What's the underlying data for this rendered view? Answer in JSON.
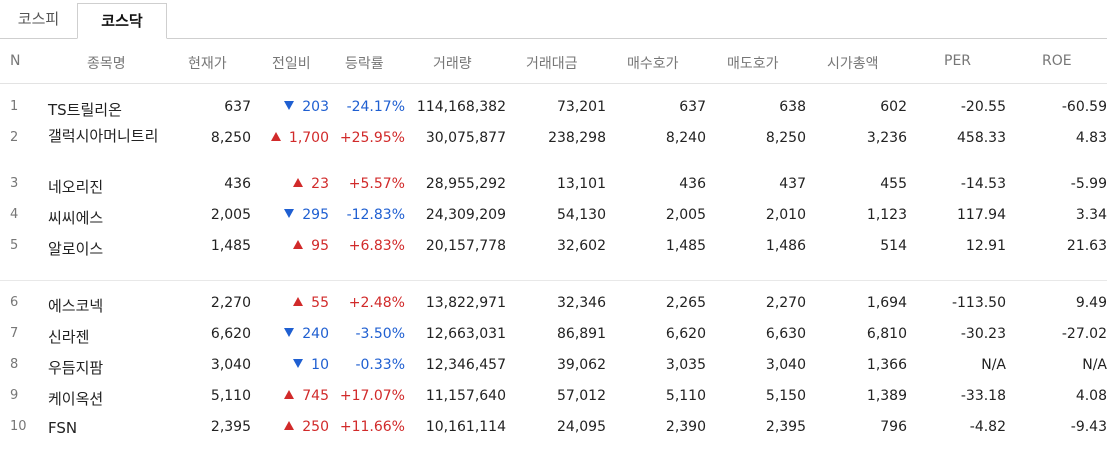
{
  "tabs": [
    {
      "label": "코스피",
      "active": false
    },
    {
      "label": "코스닥",
      "active": true
    }
  ],
  "columns": {
    "no": "N",
    "name": "종목명",
    "price": "현재가",
    "change": "전일비",
    "rate": "등락률",
    "volume": "거래량",
    "amount": "거래대금",
    "bid": "매수호가",
    "ask": "매도호가",
    "market_cap": "시가총액",
    "per": "PER",
    "roe": "ROE"
  },
  "colors": {
    "up": "#d12a2a",
    "down": "#1f5fd1"
  },
  "rows": [
    {
      "no": "1",
      "name": "TS트릴리온",
      "price": "637",
      "direction": "down",
      "change": "203",
      "rate": "-24.17%",
      "volume": "114,168,382",
      "amount": "73,201",
      "bid": "637",
      "ask": "638",
      "market_cap": "602",
      "per": "-20.55",
      "roe": "-60.59"
    },
    {
      "no": "2",
      "name": "갤럭시아머니트리",
      "price": "8,250",
      "direction": "up",
      "change": "1,700",
      "rate": "+25.95%",
      "volume": "30,075,877",
      "amount": "238,298",
      "bid": "8,240",
      "ask": "8,250",
      "market_cap": "3,236",
      "per": "458.33",
      "roe": "4.83"
    },
    {
      "no": "3",
      "name": "네오리진",
      "price": "436",
      "direction": "up",
      "change": "23",
      "rate": "+5.57%",
      "volume": "28,955,292",
      "amount": "13,101",
      "bid": "436",
      "ask": "437",
      "market_cap": "455",
      "per": "-14.53",
      "roe": "-5.99"
    },
    {
      "no": "4",
      "name": "씨씨에스",
      "price": "2,005",
      "direction": "down",
      "change": "295",
      "rate": "-12.83%",
      "volume": "24,309,209",
      "amount": "54,130",
      "bid": "2,005",
      "ask": "2,010",
      "market_cap": "1,123",
      "per": "117.94",
      "roe": "3.34"
    },
    {
      "no": "5",
      "name": "알로이스",
      "price": "1,485",
      "direction": "up",
      "change": "95",
      "rate": "+6.83%",
      "volume": "20,157,778",
      "amount": "32,602",
      "bid": "1,485",
      "ask": "1,486",
      "market_cap": "514",
      "per": "12.91",
      "roe": "21.63"
    },
    {
      "no": "6",
      "name": "에스코넥",
      "price": "2,270",
      "direction": "up",
      "change": "55",
      "rate": "+2.48%",
      "volume": "13,822,971",
      "amount": "32,346",
      "bid": "2,265",
      "ask": "2,270",
      "market_cap": "1,694",
      "per": "-113.50",
      "roe": "9.49"
    },
    {
      "no": "7",
      "name": "신라젠",
      "price": "6,620",
      "direction": "down",
      "change": "240",
      "rate": "-3.50%",
      "volume": "12,663,031",
      "amount": "86,891",
      "bid": "6,620",
      "ask": "6,630",
      "market_cap": "6,810",
      "per": "-30.23",
      "roe": "-27.02"
    },
    {
      "no": "8",
      "name": "우듬지팜",
      "price": "3,040",
      "direction": "down",
      "change": "10",
      "rate": "-0.33%",
      "volume": "12,346,457",
      "amount": "39,062",
      "bid": "3,035",
      "ask": "3,040",
      "market_cap": "1,366",
      "per": "N/A",
      "roe": "N/A"
    },
    {
      "no": "9",
      "name": "케이옥션",
      "price": "5,110",
      "direction": "up",
      "change": "745",
      "rate": "+17.07%",
      "volume": "11,157,640",
      "amount": "57,012",
      "bid": "5,110",
      "ask": "5,150",
      "market_cap": "1,389",
      "per": "-33.18",
      "roe": "4.08"
    },
    {
      "no": "10",
      "name": "FSN",
      "price": "2,395",
      "direction": "up",
      "change": "250",
      "rate": "+11.66%",
      "volume": "10,161,114",
      "amount": "24,095",
      "bid": "2,390",
      "ask": "2,395",
      "market_cap": "796",
      "per": "-4.82",
      "roe": "-9.43"
    }
  ]
}
